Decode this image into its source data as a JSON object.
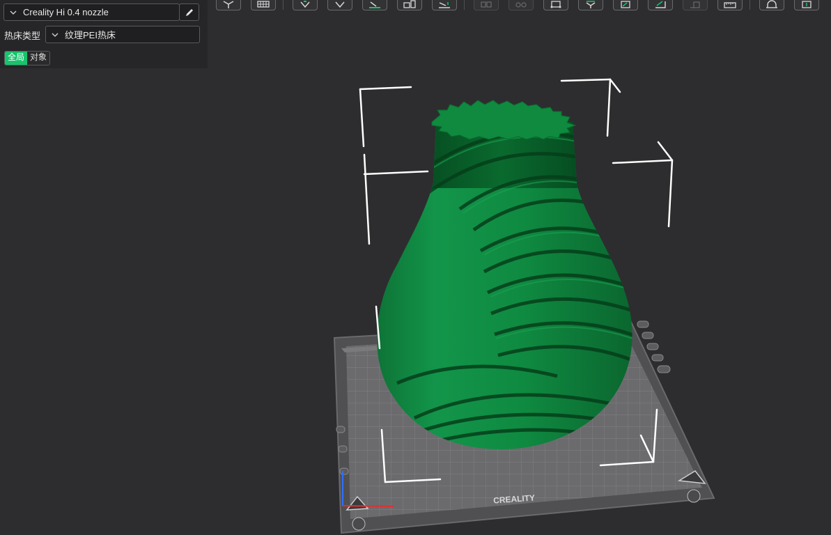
{
  "left_panel": {
    "printer": {
      "selected": "Creality Hi 0.4 nozzle",
      "edit_icon": "pencil-icon"
    },
    "bed_type": {
      "label": "热床类型",
      "selected": "纹理PEI热床"
    },
    "scope_toggle": {
      "options": [
        "全局",
        "对象"
      ],
      "active": "全局"
    }
  },
  "toolbar": {
    "tools": [
      {
        "name": "add-cube-tool",
        "icon": "cube-icon",
        "enabled": true
      },
      {
        "name": "arrange-grid-tool",
        "icon": "grid-icon",
        "enabled": true
      },
      {
        "name": "auto-orient-tool",
        "icon": "orient-icon",
        "enabled": true
      },
      {
        "name": "lay-on-face-tool",
        "icon": "diamond-icon",
        "enabled": true
      },
      {
        "name": "place-on-bed-tool",
        "icon": "bed-place-icon",
        "enabled": true
      },
      {
        "name": "split-tool",
        "icon": "split-icon",
        "enabled": true
      },
      {
        "name": "cut-tool",
        "icon": "cut-icon",
        "enabled": true
      },
      {
        "name": "layout-tool",
        "icon": "layout-icon",
        "enabled": false
      },
      {
        "name": "settings-tool",
        "icon": "gears-icon",
        "enabled": false
      },
      {
        "name": "scale-tool",
        "icon": "scale-box-icon",
        "enabled": true
      },
      {
        "name": "rotate-tool",
        "icon": "rotate-cube-icon",
        "enabled": true
      },
      {
        "name": "support-paint-tool",
        "icon": "paint-icon",
        "enabled": true
      },
      {
        "name": "seam-paint-tool",
        "icon": "seam-icon",
        "enabled": true
      },
      {
        "name": "mirror-tool",
        "icon": "mirror-icon",
        "enabled": false
      },
      {
        "name": "measure-tool",
        "icon": "ruler-icon",
        "enabled": true
      },
      {
        "name": "assembly-tool",
        "icon": "arch-icon",
        "enabled": true
      },
      {
        "name": "text-tool",
        "icon": "text-emboss-icon",
        "enabled": true
      }
    ]
  },
  "viewport": {
    "bed_brand": "CREALITY",
    "model_color": "#0f8a3f",
    "accent_color": "#17c46c",
    "selection_color": "#ffffff"
  }
}
